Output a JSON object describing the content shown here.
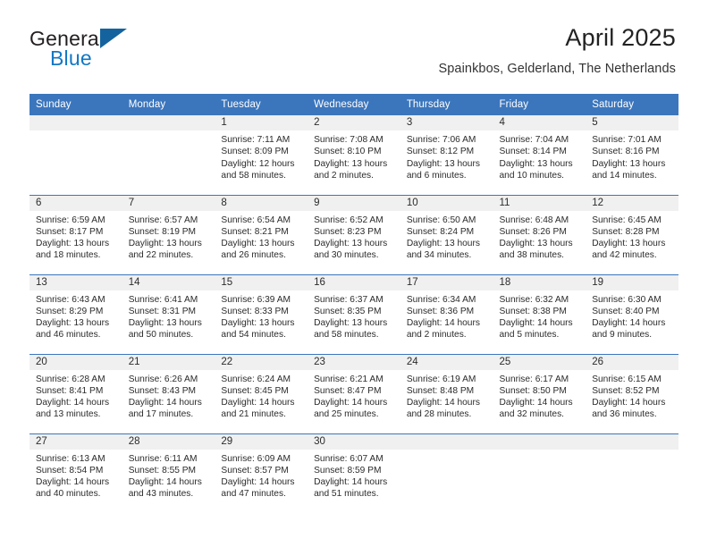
{
  "brand": {
    "name_top": "General",
    "name_bottom": "Blue",
    "accent_color": "#1277c4",
    "triangle_color": "#14639e"
  },
  "header": {
    "title": "April 2025",
    "subtitle": "Spainkbos, Gelderland, The Netherlands"
  },
  "theme": {
    "header_bg": "#3b76bd",
    "daynum_bg": "#f0f0f0",
    "text": "#2b2b2b"
  },
  "weekday_headers": [
    "Sunday",
    "Monday",
    "Tuesday",
    "Wednesday",
    "Thursday",
    "Friday",
    "Saturday"
  ],
  "weeks": [
    [
      {
        "day": "",
        "lines": []
      },
      {
        "day": "",
        "lines": []
      },
      {
        "day": "1",
        "lines": [
          "Sunrise: 7:11 AM",
          "Sunset: 8:09 PM",
          "Daylight: 12 hours",
          "and 58 minutes."
        ]
      },
      {
        "day": "2",
        "lines": [
          "Sunrise: 7:08 AM",
          "Sunset: 8:10 PM",
          "Daylight: 13 hours",
          "and 2 minutes."
        ]
      },
      {
        "day": "3",
        "lines": [
          "Sunrise: 7:06 AM",
          "Sunset: 8:12 PM",
          "Daylight: 13 hours",
          "and 6 minutes."
        ]
      },
      {
        "day": "4",
        "lines": [
          "Sunrise: 7:04 AM",
          "Sunset: 8:14 PM",
          "Daylight: 13 hours",
          "and 10 minutes."
        ]
      },
      {
        "day": "5",
        "lines": [
          "Sunrise: 7:01 AM",
          "Sunset: 8:16 PM",
          "Daylight: 13 hours",
          "and 14 minutes."
        ]
      }
    ],
    [
      {
        "day": "6",
        "lines": [
          "Sunrise: 6:59 AM",
          "Sunset: 8:17 PM",
          "Daylight: 13 hours",
          "and 18 minutes."
        ]
      },
      {
        "day": "7",
        "lines": [
          "Sunrise: 6:57 AM",
          "Sunset: 8:19 PM",
          "Daylight: 13 hours",
          "and 22 minutes."
        ]
      },
      {
        "day": "8",
        "lines": [
          "Sunrise: 6:54 AM",
          "Sunset: 8:21 PM",
          "Daylight: 13 hours",
          "and 26 minutes."
        ]
      },
      {
        "day": "9",
        "lines": [
          "Sunrise: 6:52 AM",
          "Sunset: 8:23 PM",
          "Daylight: 13 hours",
          "and 30 minutes."
        ]
      },
      {
        "day": "10",
        "lines": [
          "Sunrise: 6:50 AM",
          "Sunset: 8:24 PM",
          "Daylight: 13 hours",
          "and 34 minutes."
        ]
      },
      {
        "day": "11",
        "lines": [
          "Sunrise: 6:48 AM",
          "Sunset: 8:26 PM",
          "Daylight: 13 hours",
          "and 38 minutes."
        ]
      },
      {
        "day": "12",
        "lines": [
          "Sunrise: 6:45 AM",
          "Sunset: 8:28 PM",
          "Daylight: 13 hours",
          "and 42 minutes."
        ]
      }
    ],
    [
      {
        "day": "13",
        "lines": [
          "Sunrise: 6:43 AM",
          "Sunset: 8:29 PM",
          "Daylight: 13 hours",
          "and 46 minutes."
        ]
      },
      {
        "day": "14",
        "lines": [
          "Sunrise: 6:41 AM",
          "Sunset: 8:31 PM",
          "Daylight: 13 hours",
          "and 50 minutes."
        ]
      },
      {
        "day": "15",
        "lines": [
          "Sunrise: 6:39 AM",
          "Sunset: 8:33 PM",
          "Daylight: 13 hours",
          "and 54 minutes."
        ]
      },
      {
        "day": "16",
        "lines": [
          "Sunrise: 6:37 AM",
          "Sunset: 8:35 PM",
          "Daylight: 13 hours",
          "and 58 minutes."
        ]
      },
      {
        "day": "17",
        "lines": [
          "Sunrise: 6:34 AM",
          "Sunset: 8:36 PM",
          "Daylight: 14 hours",
          "and 2 minutes."
        ]
      },
      {
        "day": "18",
        "lines": [
          "Sunrise: 6:32 AM",
          "Sunset: 8:38 PM",
          "Daylight: 14 hours",
          "and 5 minutes."
        ]
      },
      {
        "day": "19",
        "lines": [
          "Sunrise: 6:30 AM",
          "Sunset: 8:40 PM",
          "Daylight: 14 hours",
          "and 9 minutes."
        ]
      }
    ],
    [
      {
        "day": "20",
        "lines": [
          "Sunrise: 6:28 AM",
          "Sunset: 8:41 PM",
          "Daylight: 14 hours",
          "and 13 minutes."
        ]
      },
      {
        "day": "21",
        "lines": [
          "Sunrise: 6:26 AM",
          "Sunset: 8:43 PM",
          "Daylight: 14 hours",
          "and 17 minutes."
        ]
      },
      {
        "day": "22",
        "lines": [
          "Sunrise: 6:24 AM",
          "Sunset: 8:45 PM",
          "Daylight: 14 hours",
          "and 21 minutes."
        ]
      },
      {
        "day": "23",
        "lines": [
          "Sunrise: 6:21 AM",
          "Sunset: 8:47 PM",
          "Daylight: 14 hours",
          "and 25 minutes."
        ]
      },
      {
        "day": "24",
        "lines": [
          "Sunrise: 6:19 AM",
          "Sunset: 8:48 PM",
          "Daylight: 14 hours",
          "and 28 minutes."
        ]
      },
      {
        "day": "25",
        "lines": [
          "Sunrise: 6:17 AM",
          "Sunset: 8:50 PM",
          "Daylight: 14 hours",
          "and 32 minutes."
        ]
      },
      {
        "day": "26",
        "lines": [
          "Sunrise: 6:15 AM",
          "Sunset: 8:52 PM",
          "Daylight: 14 hours",
          "and 36 minutes."
        ]
      }
    ],
    [
      {
        "day": "27",
        "lines": [
          "Sunrise: 6:13 AM",
          "Sunset: 8:54 PM",
          "Daylight: 14 hours",
          "and 40 minutes."
        ]
      },
      {
        "day": "28",
        "lines": [
          "Sunrise: 6:11 AM",
          "Sunset: 8:55 PM",
          "Daylight: 14 hours",
          "and 43 minutes."
        ]
      },
      {
        "day": "29",
        "lines": [
          "Sunrise: 6:09 AM",
          "Sunset: 8:57 PM",
          "Daylight: 14 hours",
          "and 47 minutes."
        ]
      },
      {
        "day": "30",
        "lines": [
          "Sunrise: 6:07 AM",
          "Sunset: 8:59 PM",
          "Daylight: 14 hours",
          "and 51 minutes."
        ]
      },
      {
        "day": "",
        "lines": []
      },
      {
        "day": "",
        "lines": []
      },
      {
        "day": "",
        "lines": []
      }
    ]
  ]
}
